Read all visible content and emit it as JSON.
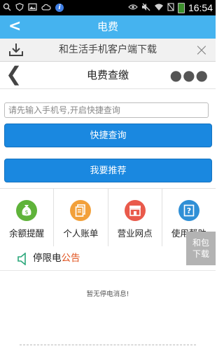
{
  "status_bar": {
    "left_icons": [
      "search-icon",
      "shield-icon",
      "image-icon",
      "cloud-icon",
      "info-icon"
    ],
    "right_icons": [
      "eye-icon",
      "mute-icon",
      "wifi-icon",
      "battery-icon"
    ],
    "info_glyph": "i",
    "time": "16:54"
  },
  "title_bar": {
    "back_glyph": "<",
    "title": "电费"
  },
  "banner": {
    "text": "和生活手机客户端下载",
    "close_glyph": "×"
  },
  "sub_nav": {
    "back_glyph": "❮",
    "title": "电费查缴",
    "more_glyph": "●●●"
  },
  "form": {
    "phone_placeholder": "请先输入手机号,开启快捷查询",
    "phone_value": "",
    "quick_query_label": "快捷查询",
    "recommend_label": "我要推荐"
  },
  "grid": {
    "items": [
      {
        "label": "余额提醒",
        "icon": "money-bag-icon",
        "color": "#5fb33a",
        "glyph": "$"
      },
      {
        "label": "个人账单",
        "icon": "bill-icon",
        "color": "#f2a03a"
      },
      {
        "label": "营业网点",
        "icon": "store-icon",
        "color": "#e95a4b"
      },
      {
        "label": "使用帮助",
        "icon": "help-icon",
        "color": "#2f8fd6",
        "glyph": "?"
      }
    ]
  },
  "side_float": {
    "line1": "和包",
    "line2": "下载"
  },
  "notice": {
    "prefix": "停限电",
    "highlight": "公告",
    "highlight_color": "#e0531f",
    "empty_message": "暂无停电消息!"
  },
  "colors": {
    "title_bar": "#45b3ef",
    "button": "#1a88e0"
  }
}
